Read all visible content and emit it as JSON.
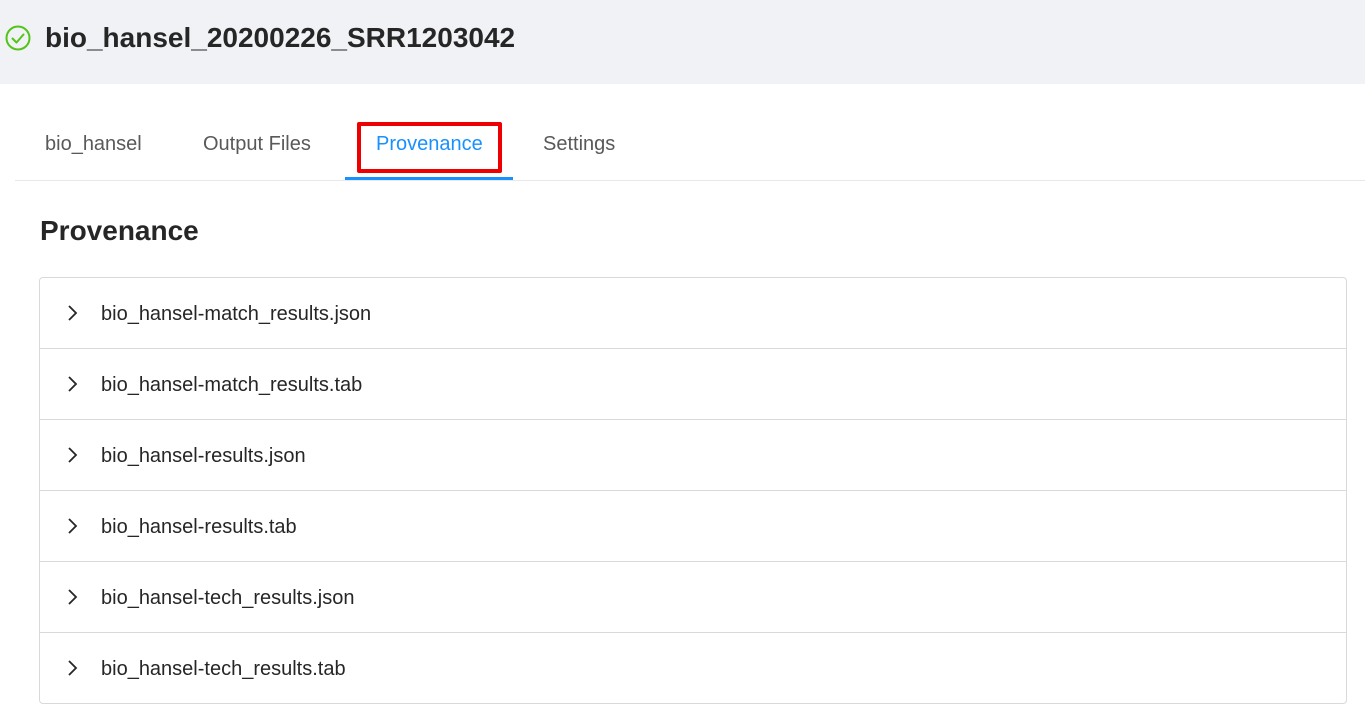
{
  "header": {
    "title": "bio_hansel_20200226_SRR1203042",
    "status_icon": "check-circle-icon",
    "status_color": "#52c41a"
  },
  "tabs": [
    {
      "label": "bio_hansel",
      "active": false
    },
    {
      "label": "Output Files",
      "active": false
    },
    {
      "label": "Provenance",
      "active": true
    },
    {
      "label": "Settings",
      "active": false
    }
  ],
  "accent_color": "#1890ff",
  "highlight_color": "#ee0000",
  "section": {
    "title": "Provenance"
  },
  "files": [
    {
      "label": "bio_hansel-match_results.json",
      "icon": "chevron-right-icon"
    },
    {
      "label": "bio_hansel-match_results.tab",
      "icon": "chevron-right-icon"
    },
    {
      "label": "bio_hansel-results.json",
      "icon": "chevron-right-icon"
    },
    {
      "label": "bio_hansel-results.tab",
      "icon": "chevron-right-icon"
    },
    {
      "label": "bio_hansel-tech_results.json",
      "icon": "chevron-right-icon"
    },
    {
      "label": "bio_hansel-tech_results.tab",
      "icon": "chevron-right-icon"
    }
  ]
}
